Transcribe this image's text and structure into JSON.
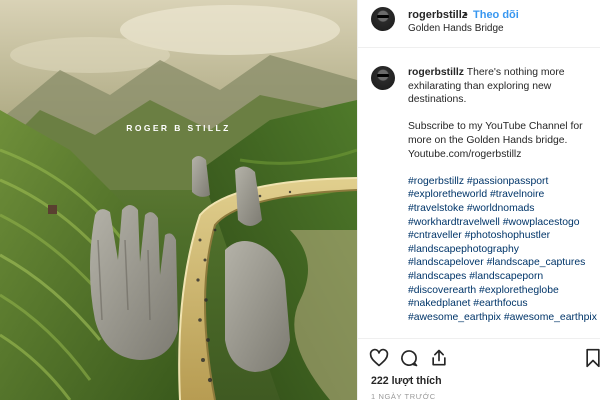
{
  "photo": {
    "watermark": "ROGER B STILLZ"
  },
  "header": {
    "username": "rogerbstillz",
    "separator": "•",
    "follow_label": "Theo dõi",
    "location": "Golden Hands Bridge"
  },
  "caption": {
    "username": "rogerbstillz",
    "text1": "There's nothing more exhilarating than exploring new destinations.",
    "text2": "Subscribe to my YouTube Channel for more on the Golden Hands bridge. Youtube.com/rogerbstillz",
    "hashtags": [
      "#rogerbstillz",
      "#passionpassport",
      "#exploretheworld",
      "#travelnoire",
      "#travelstoke",
      "#worldnomads",
      "#workhardtravelwell",
      "#wowplacestogo",
      "#cntraveller",
      "#photoshophustler",
      "#landscapephotography",
      "#landscapelover",
      "#landscape_captures",
      "#landscapes",
      "#landscapeporn",
      "#discoverearth",
      "#exploretheglobe",
      "#nakedplanet",
      "#earthfocus",
      "#awesome_earthpix",
      "#awesome_earthpix"
    ]
  },
  "actions": {
    "like_icon": "heart-icon",
    "comment_icon": "comment-icon",
    "share_icon": "share-icon",
    "save_icon": "bookmark-icon",
    "likes_text": "222 lượt thích",
    "date_text": "1 NGÀY TRƯỚC"
  },
  "colors": {
    "link_blue": "#3897f0",
    "hashtag_blue": "#003569",
    "text": "#262626",
    "muted": "#999999",
    "divider": "#efefef"
  }
}
